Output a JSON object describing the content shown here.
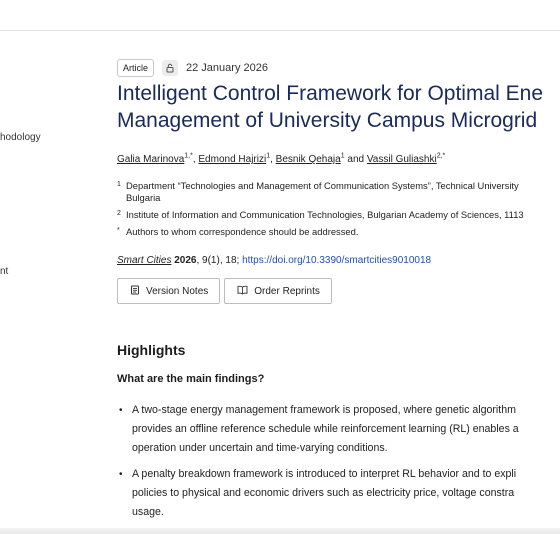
{
  "nav": {
    "fragment_1": "hodology",
    "fragment_2": "nt"
  },
  "article": {
    "type_tag": "Article",
    "open_access_icon": "open-access-icon",
    "date": "22 January 2026",
    "title_line_1": "Intelligent Control Framework for Optimal Ene",
    "title_line_2": "Management of University Campus Microgrid",
    "authors": [
      {
        "name": "Galia Marinova",
        "sup": "1,*"
      },
      {
        "name": "Edmond Hajrizi",
        "sup": "1"
      },
      {
        "name": "Besnik Qehaja",
        "sup": "1"
      },
      {
        "name": "Vassil Guliashki",
        "sup": "2,*"
      }
    ],
    "author_sep": ",",
    "author_and": "and",
    "affiliations": [
      {
        "mark": "1",
        "text": "Department “Technologies and Management of Communication Systems”, Technical University",
        "cont": "Bulgaria"
      },
      {
        "mark": "2",
        "text": "Institute of Information and Communication Technologies, Bulgarian Academy of Sciences, 1113"
      },
      {
        "mark": "*",
        "text": "Authors to whom correspondence should be addressed."
      }
    ],
    "citation": {
      "journal": "Smart Cities",
      "year": "2026",
      "rest": ", 9(1), 18; ",
      "doi": "https://doi.org/10.3390/smartcities9010018"
    },
    "buttons": {
      "version_notes": "Version Notes",
      "order_reprints": "Order Reprints"
    },
    "highlights": {
      "heading": "Highlights",
      "subheading": "What are the main findings?",
      "bullets": [
        {
          "lines": [
            "A two-stage energy management framework is proposed, where genetic algorithm",
            "provides an offline reference schedule while reinforcement learning (RL) enables a",
            "operation under uncertain and time-varying conditions."
          ]
        },
        {
          "lines": [
            "A penalty breakdown framework is introduced to interpret RL behavior and to expli",
            "policies to physical and economic drivers such as electricity price, voltage constra",
            "usage."
          ]
        }
      ]
    }
  }
}
